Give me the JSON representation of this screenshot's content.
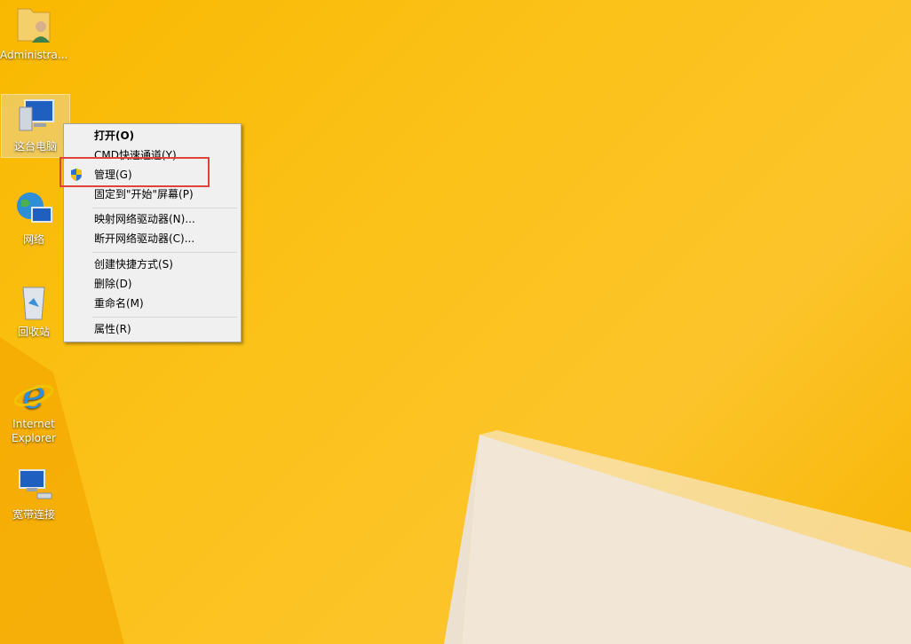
{
  "desktop": {
    "background_color": "#f9b800",
    "icons": [
      {
        "label": "Administra...",
        "icon": "user-folder-icon"
      },
      {
        "label": "这台电脑",
        "icon": "computer-icon"
      },
      {
        "label": "网络",
        "icon": "network-globe-icon"
      },
      {
        "label": "回收站",
        "icon": "recycle-bin-icon"
      },
      {
        "label": "Internet Explorer",
        "icon": "internet-explorer-icon"
      },
      {
        "label": "宽带连接",
        "icon": "broadband-connection-icon"
      }
    ]
  },
  "context_menu": {
    "items": [
      {
        "label": "打开(O)"
      },
      {
        "label": "CMD快速通道(Y)"
      },
      {
        "label": "管理(G)",
        "icon": "uac-shield-icon"
      },
      {
        "label": "固定到\"开始\"屏幕(P)"
      },
      {
        "label": "映射网络驱动器(N)..."
      },
      {
        "label": "断开网络驱动器(C)..."
      },
      {
        "label": "创建快捷方式(S)"
      },
      {
        "label": "删除(D)"
      },
      {
        "label": "重命名(M)"
      },
      {
        "label": "属性(R)"
      }
    ]
  },
  "highlight_color": "#e0413b"
}
